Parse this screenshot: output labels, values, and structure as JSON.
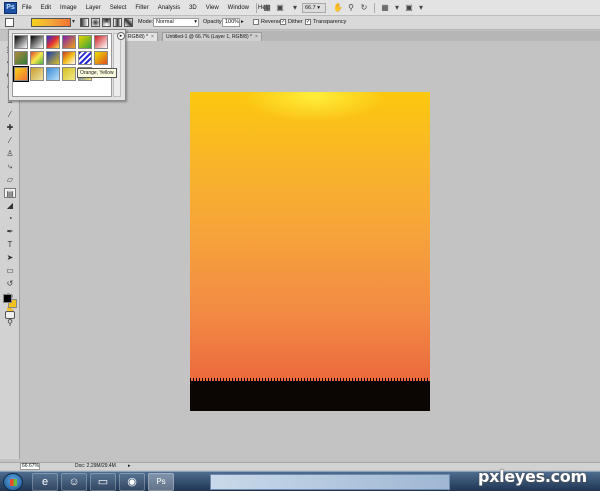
{
  "app": {
    "logo_text": "Ps"
  },
  "menu": [
    "File",
    "Edit",
    "Image",
    "Layer",
    "Select",
    "Filter",
    "Analysis",
    "3D",
    "View",
    "Window",
    "Help"
  ],
  "appbar": {
    "zoom_value": "66.7"
  },
  "options": {
    "mode_label": "Mode:",
    "mode_value": "Normal",
    "opacity_label": "Opacity:",
    "opacity_value": "100%",
    "reverse_label": "Reverse",
    "reverse_checked": false,
    "dither_label": "Dither",
    "dither_checked": true,
    "transparency_label": "Transparency",
    "transparency_checked": true
  },
  "tabs": [
    {
      "label": "RGB/8) *",
      "active": true
    },
    {
      "label": "Untitled-1 @ 66.7% (Layer 1, RGB/8) *",
      "active": false
    }
  ],
  "gradient_picker": {
    "tooltip": "Orange, Yellow",
    "menu_icon": "▸",
    "presets": [
      {
        "css": "linear-gradient(135deg,#000,#fff)"
      },
      {
        "css": "linear-gradient(135deg,#000,#fff)"
      },
      {
        "css": "linear-gradient(135deg,#2b2bd8,#e03030,#f3e04b)"
      },
      {
        "css": "linear-gradient(135deg,#7a1ea8,#f2a21c)"
      },
      {
        "css": "linear-gradient(135deg,#e6d000,#37a53a)"
      },
      {
        "css": "linear-gradient(135deg,#cf2020,#ffffff)"
      },
      {
        "css": "linear-gradient(135deg,#b08a3c,#2f7a3a)"
      },
      {
        "css": "linear-gradient(135deg,#e24a2c,#f8e84a,#4ab04a)"
      },
      {
        "css": "linear-gradient(135deg,#1a3aa8,#d8c02a)"
      },
      {
        "css": "linear-gradient(135deg,#c93c1c,#f3c01c,#fff)"
      },
      {
        "css": "repeating-linear-gradient(135deg,#2a2ad8 0,#2a2ad8 2px,#fff 2px,#fff 4px)"
      },
      {
        "css": "linear-gradient(135deg,#e8e000,#e05020)"
      },
      {
        "css": "linear-gradient(135deg,#f4d21c,#f27232)"
      },
      {
        "css": "linear-gradient(135deg,#c9a030,#ece0a0)"
      },
      {
        "css": "linear-gradient(135deg,#3a8ad8,#b8e0f8)"
      },
      {
        "css": "linear-gradient(135deg,#d8c020,#f0ea88)"
      },
      {
        "css": "linear-gradient(135deg,#2a5ad8,#f8e868)"
      }
    ],
    "selected_index": 12
  },
  "tools": [
    {
      "icon": "marquee-icon",
      "glyph": "⬚"
    },
    {
      "icon": "move-icon",
      "glyph": "✥"
    },
    {
      "icon": "lasso-icon",
      "glyph": "ʘ"
    },
    {
      "icon": "quick-select-icon",
      "glyph": "✎"
    },
    {
      "icon": "crop-icon",
      "glyph": "⌗"
    },
    {
      "icon": "eyedropper-icon",
      "glyph": "⁄"
    },
    {
      "icon": "healing-icon",
      "glyph": "✚"
    },
    {
      "icon": "brush-icon",
      "glyph": "⁄"
    },
    {
      "icon": "clone-stamp-icon",
      "glyph": "♙"
    },
    {
      "icon": "history-brush-icon",
      "glyph": "⤷"
    },
    {
      "icon": "eraser-icon",
      "glyph": "▱"
    },
    {
      "icon": "gradient-icon",
      "glyph": "▤",
      "active": true
    },
    {
      "icon": "blur-icon",
      "glyph": "◢"
    },
    {
      "icon": "dodge-icon",
      "glyph": "◔"
    },
    {
      "icon": "pen-icon",
      "glyph": "✒"
    },
    {
      "icon": "type-icon",
      "glyph": "T"
    },
    {
      "icon": "path-select-icon",
      "glyph": "➤"
    },
    {
      "icon": "shape-icon",
      "glyph": "▭"
    },
    {
      "icon": "3d-rotate-icon",
      "glyph": "↺"
    },
    {
      "icon": "3d-orbit-icon",
      "glyph": "↻"
    },
    {
      "icon": "hand-icon",
      "glyph": "✋"
    },
    {
      "icon": "zoom-icon",
      "glyph": "⚲"
    }
  ],
  "colors": {
    "foreground": "#000000",
    "background": "#f3c21c"
  },
  "status": {
    "zoom": "66.67%",
    "doc_info": "Doc: 2.29M/29.4M",
    "arrow": "▸"
  },
  "taskbar": [
    {
      "icon": "ie-icon",
      "glyph": "e"
    },
    {
      "icon": "messenger-icon",
      "glyph": "☺"
    },
    {
      "icon": "folder-icon",
      "glyph": "▭"
    },
    {
      "icon": "firefox-icon",
      "glyph": "◉"
    },
    {
      "icon": "photoshop-icon",
      "glyph": "Ps",
      "active": true
    }
  ],
  "watermark": "pxleyes.com"
}
